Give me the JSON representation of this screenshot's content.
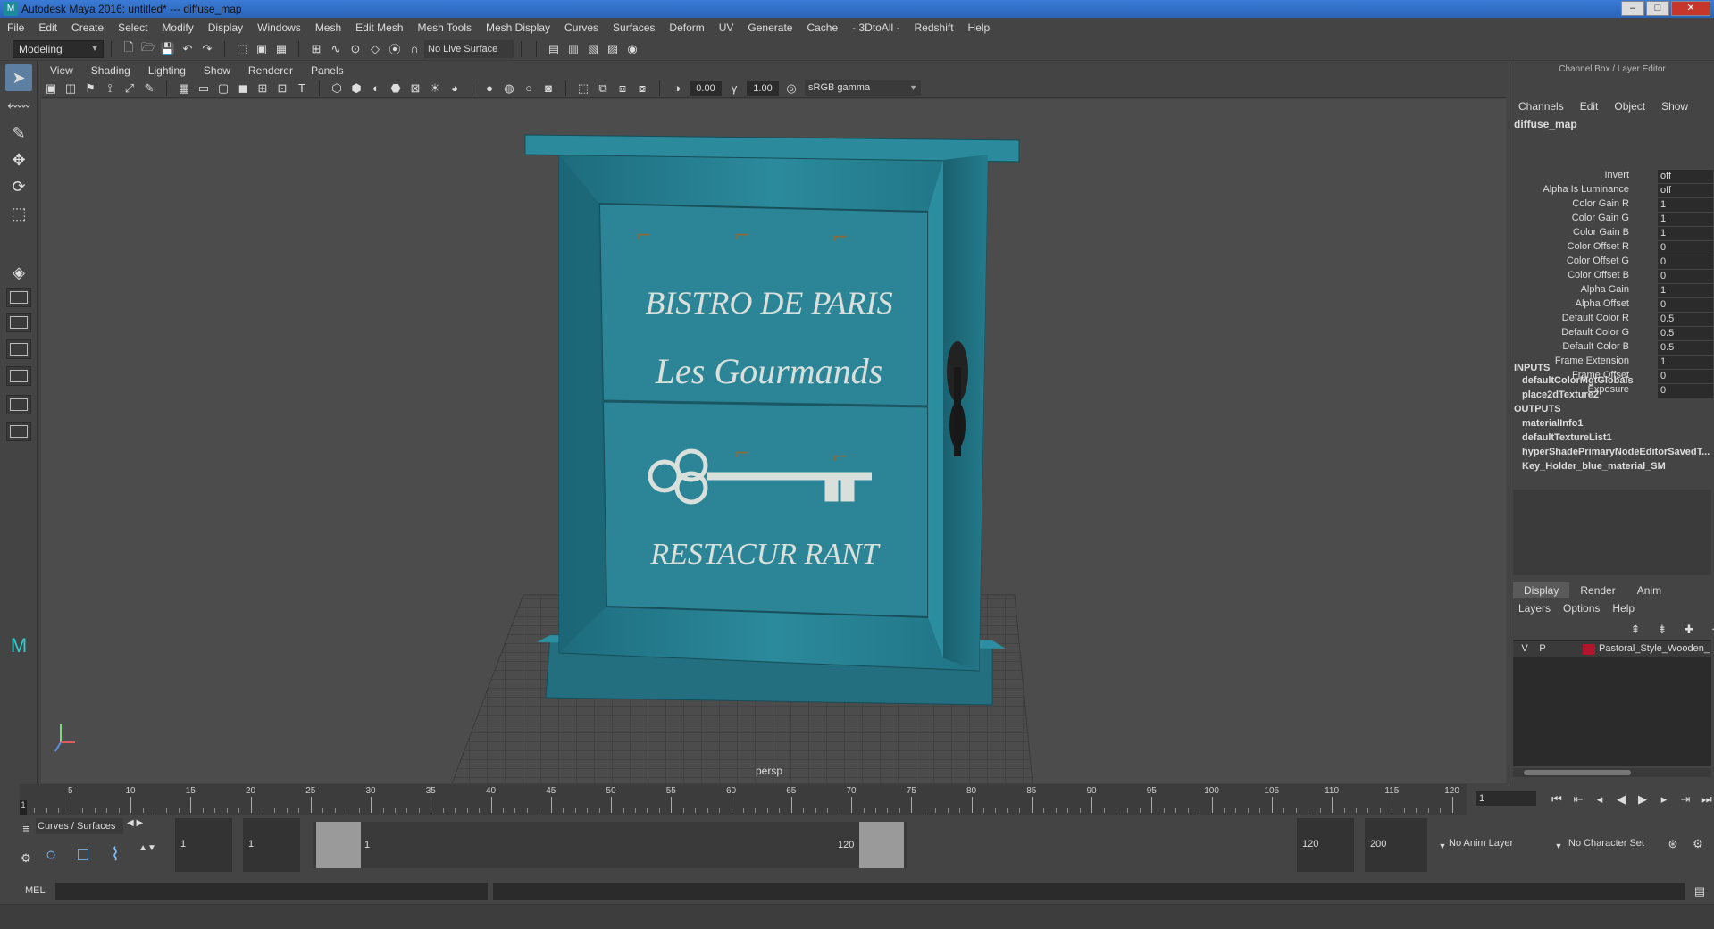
{
  "window": {
    "title": "Autodesk Maya 2016: untitled*   ---   diffuse_map"
  },
  "menubar": [
    "File",
    "Edit",
    "Create",
    "Select",
    "Modify",
    "Display",
    "Windows",
    "Mesh",
    "Edit Mesh",
    "Mesh Tools",
    "Mesh Display",
    "Curves",
    "Surfaces",
    "Deform",
    "UV",
    "Generate",
    "Cache",
    "- 3DtoAll -",
    "Redshift",
    "Help"
  ],
  "statusline": {
    "mode": "Modeling",
    "live_surface": "No Live Surface"
  },
  "viewport": {
    "menus": [
      "View",
      "Shading",
      "Lighting",
      "Show",
      "Renderer",
      "Panels"
    ],
    "exposure": "0.00",
    "gamma": "1.00",
    "color_space": "sRGB gamma",
    "camera": "persp",
    "model_text": {
      "line1": "BISTRO DE PARIS",
      "line2": "Les Gourmands",
      "line3": "RESTACUR RANT"
    }
  },
  "channelbox": {
    "header": "Channel Box / Layer Editor",
    "menus": [
      "Channels",
      "Edit",
      "Object",
      "Show"
    ],
    "node": "diffuse_map",
    "attributes": [
      {
        "label": "Invert",
        "value": "off"
      },
      {
        "label": "Alpha Is Luminance",
        "value": "off"
      },
      {
        "label": "Color Gain R",
        "value": "1"
      },
      {
        "label": "Color Gain G",
        "value": "1"
      },
      {
        "label": "Color Gain B",
        "value": "1"
      },
      {
        "label": "Color Offset R",
        "value": "0"
      },
      {
        "label": "Color Offset G",
        "value": "0"
      },
      {
        "label": "Color Offset B",
        "value": "0"
      },
      {
        "label": "Alpha Gain",
        "value": "1"
      },
      {
        "label": "Alpha Offset",
        "value": "0"
      },
      {
        "label": "Default Color R",
        "value": "0.5"
      },
      {
        "label": "Default Color G",
        "value": "0.5"
      },
      {
        "label": "Default Color B",
        "value": "0.5"
      },
      {
        "label": "Frame Extension",
        "value": "1"
      },
      {
        "label": "Frame Offset",
        "value": "0"
      },
      {
        "label": "Exposure",
        "value": "0"
      }
    ],
    "inputs_title": "INPUTS",
    "inputs": [
      "defaultColorMgtGlobals",
      "place2dTexture2"
    ],
    "outputs_title": "OUTPUTS",
    "outputs": [
      "materialInfo1",
      "defaultTextureList1",
      "hyperShadePrimaryNodeEditorSavedT...",
      "Key_Holder_blue_material_SM"
    ]
  },
  "layer_editor": {
    "tabs": [
      "Display",
      "Render",
      "Anim"
    ],
    "menus": [
      "Layers",
      "Options",
      "Help"
    ],
    "layer": {
      "v": "V",
      "p": "P",
      "name": "Pastoral_Style_Wooden_",
      "color": "#b0152b"
    }
  },
  "timeline": {
    "ticks": [
      5,
      10,
      15,
      20,
      25,
      30,
      35,
      40,
      45,
      50,
      55,
      60,
      65,
      70,
      75,
      80,
      85,
      90,
      95,
      100,
      105,
      110,
      115,
      120
    ],
    "current_frame": "1",
    "frame_field": "1"
  },
  "range": {
    "shelf_tab": "Curves / Surfaces",
    "start": "1",
    "start2": "1",
    "range_start_label": "1",
    "range_end_label": "120",
    "end": "120",
    "end2": "200",
    "anim_layer": "No Anim Layer",
    "character_set": "No Character Set"
  },
  "cmdline": {
    "label": "MEL"
  }
}
